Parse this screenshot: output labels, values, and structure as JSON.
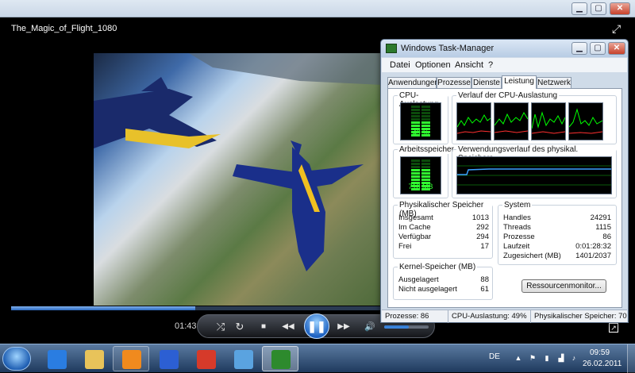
{
  "player": {
    "title": "The_Magic_of_Flight_1080",
    "time": "01:43",
    "seek_progress": 0.3,
    "volume_level": 0.55,
    "window_buttons": {
      "minimize": "▁",
      "maximize": "▢",
      "close": "✕"
    },
    "icons": {
      "fullscreen": "fullscreen-icon",
      "shuffle": "shuffle-icon",
      "repeat": "repeat-icon",
      "stop": "stop-icon",
      "previous": "previous-icon",
      "play_pause": "pause-icon",
      "next": "next-icon",
      "volume": "volume-icon",
      "switch_mode": "switch-to-library-icon"
    },
    "glyphs": {
      "shuffle": "⤮",
      "repeat": "↻",
      "stop": "■",
      "previous": "◀◀",
      "pause": "❚❚",
      "next": "▶▶",
      "volume": "🔊",
      "fullscreen": "⤢",
      "switch": "↗"
    }
  },
  "taskmgr": {
    "title": "Windows Task-Manager",
    "window_buttons": {
      "minimize": "▁",
      "maximize": "▢",
      "close": "✕"
    },
    "menu": [
      "Datei",
      "Optionen",
      "Ansicht",
      "?"
    ],
    "tabs": [
      "Anwendungen",
      "Prozesse",
      "Dienste",
      "Leistung",
      "Netzwerk"
    ],
    "active_tab": "Leistung",
    "cpu": {
      "label": "CPU-Auslastung",
      "value": "49 %",
      "level": 0.49
    },
    "cpu_history": {
      "label": "Verlauf der CPU-Auslastung"
    },
    "memory": {
      "label": "Arbeitsspeicher",
      "value": "718 MB",
      "level": 0.7
    },
    "memory_history": {
      "label": "Verwendungsverlauf des physikal. Speichers"
    },
    "physical": {
      "label": "Physikalischer Speicher (MB)",
      "rows": [
        {
          "k": "Insgesamt",
          "v": "1013"
        },
        {
          "k": "Im Cache",
          "v": "292"
        },
        {
          "k": "Verfügbar",
          "v": "294"
        },
        {
          "k": "Frei",
          "v": "17"
        }
      ]
    },
    "system": {
      "label": "System",
      "rows": [
        {
          "k": "Handles",
          "v": "24291"
        },
        {
          "k": "Threads",
          "v": "1115"
        },
        {
          "k": "Prozesse",
          "v": "86"
        },
        {
          "k": "Laufzeit",
          "v": "0:01:28:32"
        },
        {
          "k": "Zugesichert (MB)",
          "v": "1401/2037"
        }
      ]
    },
    "kernel": {
      "label": "Kernel-Speicher (MB)",
      "rows": [
        {
          "k": "Ausgelagert",
          "v": "88"
        },
        {
          "k": "Nicht ausgelagert",
          "v": "61"
        }
      ]
    },
    "resmon_button": "Ressourcenmonitor...",
    "status": {
      "processes": "Prozesse: 86",
      "cpu": "CPU-Auslastung: 49%",
      "memory": "Physikalischer Speicher: 70"
    }
  },
  "taskbar": {
    "start": "start-button",
    "buttons": [
      {
        "name": "internet-explorer-icon",
        "color": "#2a7de1",
        "state": "pinned"
      },
      {
        "name": "windows-explorer-icon",
        "color": "#e8c35a",
        "state": "pinned"
      },
      {
        "name": "media-player-icon",
        "color": "#f08a1e",
        "state": "open"
      },
      {
        "name": "messenger-icon",
        "color": "#2c5fd3",
        "state": "pinned"
      },
      {
        "name": "pushpin-icon",
        "color": "#d63a2a",
        "state": "pinned"
      },
      {
        "name": "control-panel-icon",
        "color": "#5aa3e0",
        "state": "pinned"
      },
      {
        "name": "task-manager-icon",
        "color": "#2d8a2d",
        "state": "active"
      }
    ],
    "tray": {
      "language": "DE",
      "icons": [
        "arrow-up-icon",
        "flag-icon",
        "power-icon",
        "network-icon",
        "volume-icon"
      ],
      "glyphs": [
        "▲",
        "⚑",
        "▮",
        "▟",
        "♪"
      ],
      "time": "09:59",
      "date": "26.02.2011"
    }
  },
  "colors": {
    "accent": "#2b69c0",
    "meter_green": "#31ff31",
    "graph_green": "#00ff00"
  }
}
